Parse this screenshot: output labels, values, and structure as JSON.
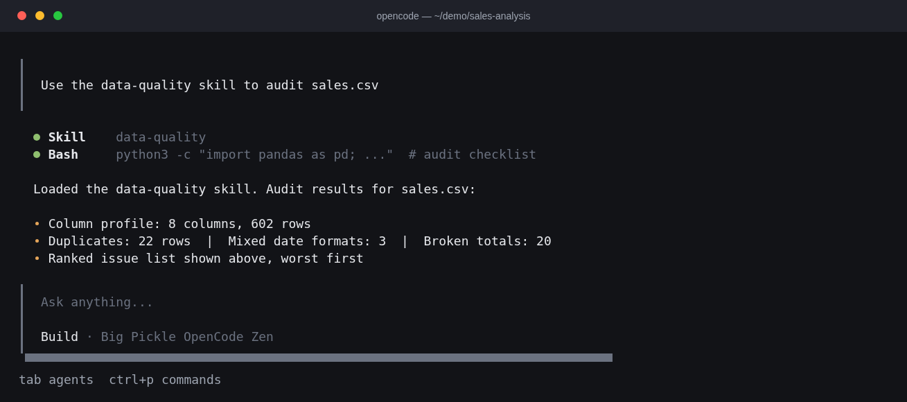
{
  "window": {
    "title": "opencode — ~/demo/sales-analysis"
  },
  "user_message": "Use the data-quality skill to audit sales.csv",
  "tool_calls": [
    {
      "name": "Skill",
      "detail": "data-quality",
      "color": "#8fbf6f"
    },
    {
      "name": "Bash",
      "detail": "python3 -c \"import pandas as pd; ...\"  # audit checklist",
      "color": "#8fbf6f"
    }
  ],
  "response": {
    "intro": "Loaded the data-quality skill. Audit results for sales.csv:",
    "bullets": [
      "Column profile: 8 columns, 602 rows",
      "Duplicates: 22 rows  |  Mixed date formats: 3  |  Broken totals: 20",
      "Ranked issue list shown above, worst first"
    ]
  },
  "input": {
    "placeholder": "Ask anything...",
    "agent": "Build",
    "separator": "·",
    "model": "Big Pickle OpenCode Zen"
  },
  "hints": [
    {
      "key": "tab",
      "label": "agents"
    },
    {
      "key": "ctrl+p",
      "label": "commands"
    }
  ]
}
